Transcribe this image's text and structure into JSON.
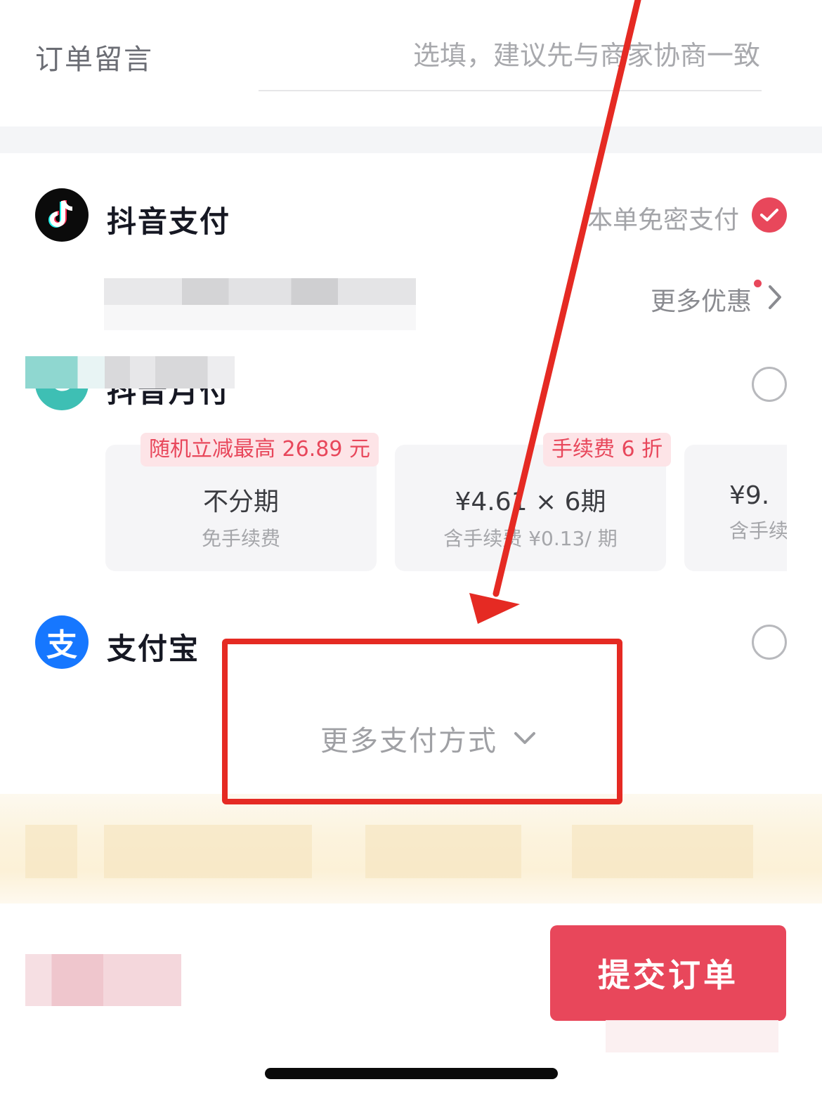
{
  "remark": {
    "label": "订单留言",
    "placeholder": "选填，建议先与商家协商一致"
  },
  "payment_methods": [
    {
      "name": "抖音支付",
      "icon": "douyin-logo-icon",
      "extra_label": "本单免密支付",
      "selected": true,
      "more_deals_label": "更多优惠"
    },
    {
      "name": "抖音月付",
      "icon": "douyin-monthly-icon",
      "selected": false,
      "plans": [
        {
          "tag": "随机立减最高 26.89 元",
          "main": "不分期",
          "sub": "免手续费"
        },
        {
          "tag": "手续费 6 折",
          "main": "¥4.61 × 6期",
          "sub": "含手续费 ¥0.13/ 期"
        },
        {
          "tag": "",
          "main": "¥9.",
          "sub": "含手续"
        }
      ]
    },
    {
      "name": "支付宝",
      "icon": "alipay-icon",
      "icon_glyph": "支",
      "selected": false
    }
  ],
  "more_methods_label": "更多支付方式",
  "submit_label": "提交订单",
  "colors": {
    "accent": "#e8475b",
    "annotation_red": "#e52a23",
    "alipay_blue": "#1677ff"
  }
}
